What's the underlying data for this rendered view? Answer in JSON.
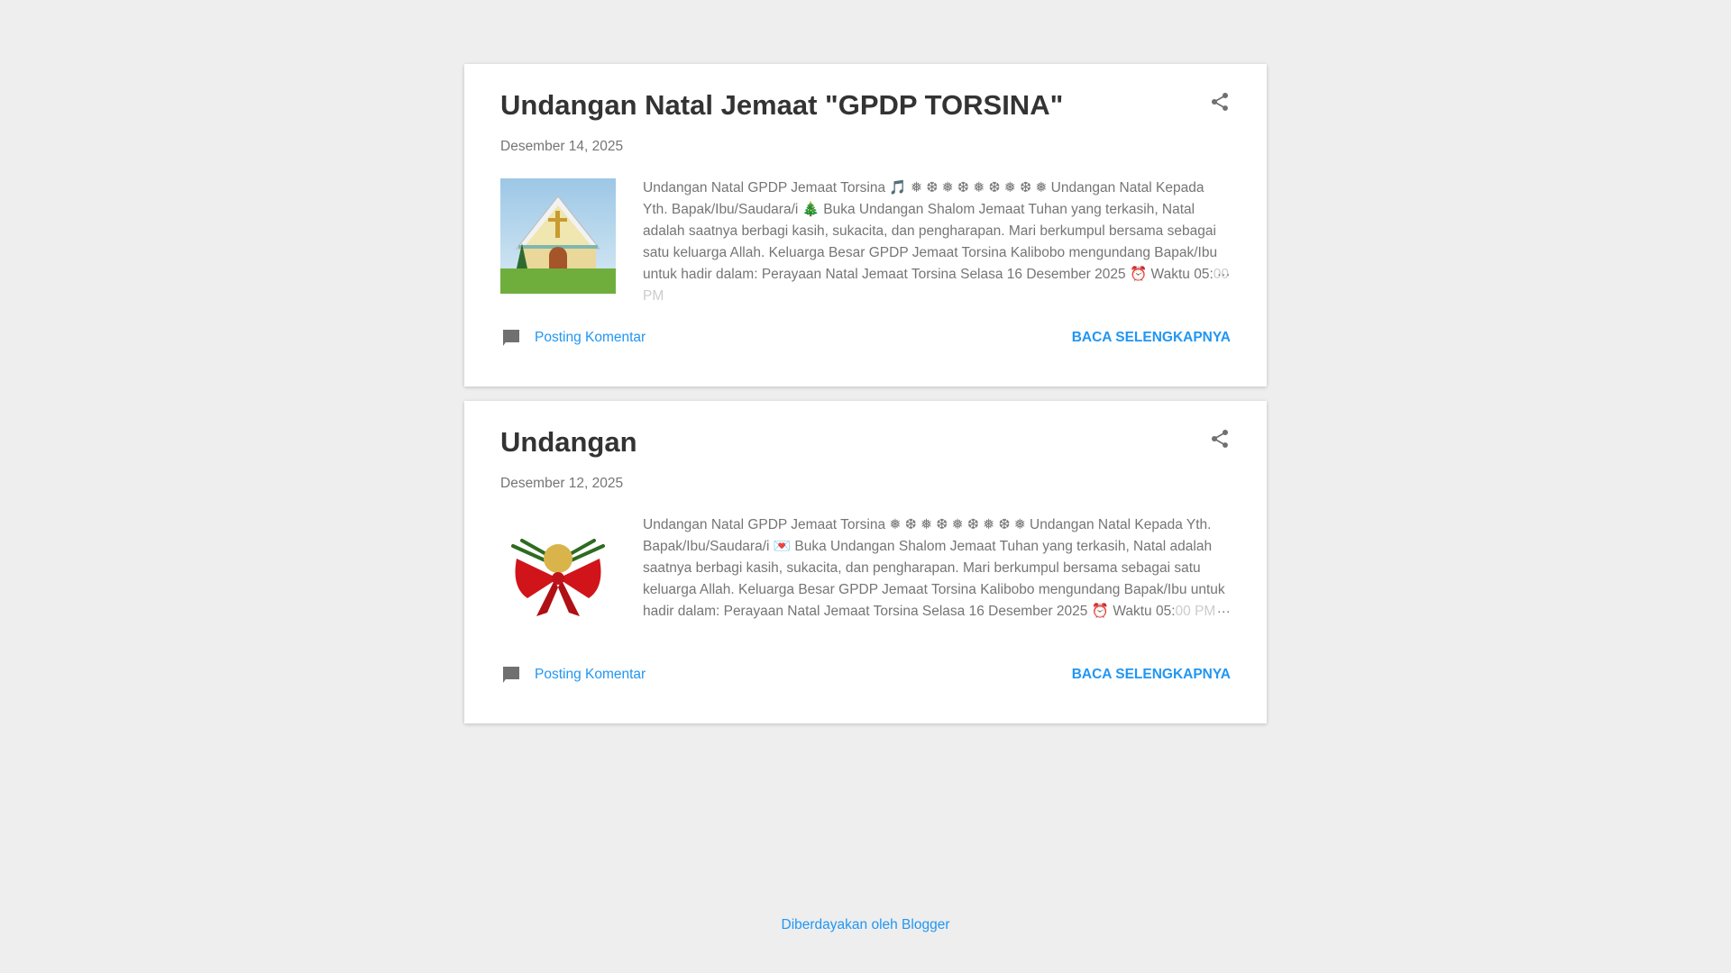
{
  "posts": [
    {
      "title": "Undangan Natal Jemaat \"GPDP TORSINA\"",
      "date": "Desember 14, 2025",
      "snippet": "Undangan Natal GPDP Jemaat Torsina 🎵 ❅ ❆ ❅ ❆ ❅ ❆ ❅ ❆ ❅ Undangan Natal Kepada Yth. Bapak/Ibu/Saudara/i 🎄 Buka Undangan Shalom Jemaat Tuhan yang terkasih, Natal adalah saatnya berbagi kasih, sukacita, dan pengharapan. Mari berkumpul bersama sebagai satu keluarga Allah. Keluarga Besar GPDP Jemaat Torsina Kalibobo mengundang Bapak/Ibu untuk hadir dalam: Perayaan Natal Jemaat Torsina Selasa 16 Desember 2025 ⏰ Waktu 05:",
      "snippet_fade": "00 PM",
      "ellipsis": "…",
      "comments": "Posting Komentar",
      "more": "BACA SELENGKAPNYA"
    },
    {
      "title": "Undangan",
      "date": "Desember 12, 2025",
      "snippet": "Undangan Natal GPDP Jemaat Torsina ❅ ❆ ❅ ❆ ❅ ❆ ❅ ❆ ❅ Undangan Natal Kepada Yth. Bapak/Ibu/Saudara/i 💌 Buka Undangan Shalom Jemaat Tuhan yang terkasih, Natal adalah saatnya berbagi kasih, sukacita, dan pengharapan. Mari berkumpul bersama sebagai satu keluarga Allah. Keluarga Besar GPDP Jemaat Torsina Kalibobo mengundang Bapak/Ibu untuk hadir dalam: Perayaan Natal Jemaat Torsina Selasa 16 Desember 2025 ⏰ Waktu 05:",
      "snippet_fade": "00 PM",
      "ellipsis": "…",
      "comments": "Posting Komentar",
      "more": "BACA SELENGKAPNYA"
    }
  ],
  "footer": "Diberdayakan oleh Blogger",
  "colors": {
    "accent": "#2196f3",
    "background": "#eeeeee"
  }
}
